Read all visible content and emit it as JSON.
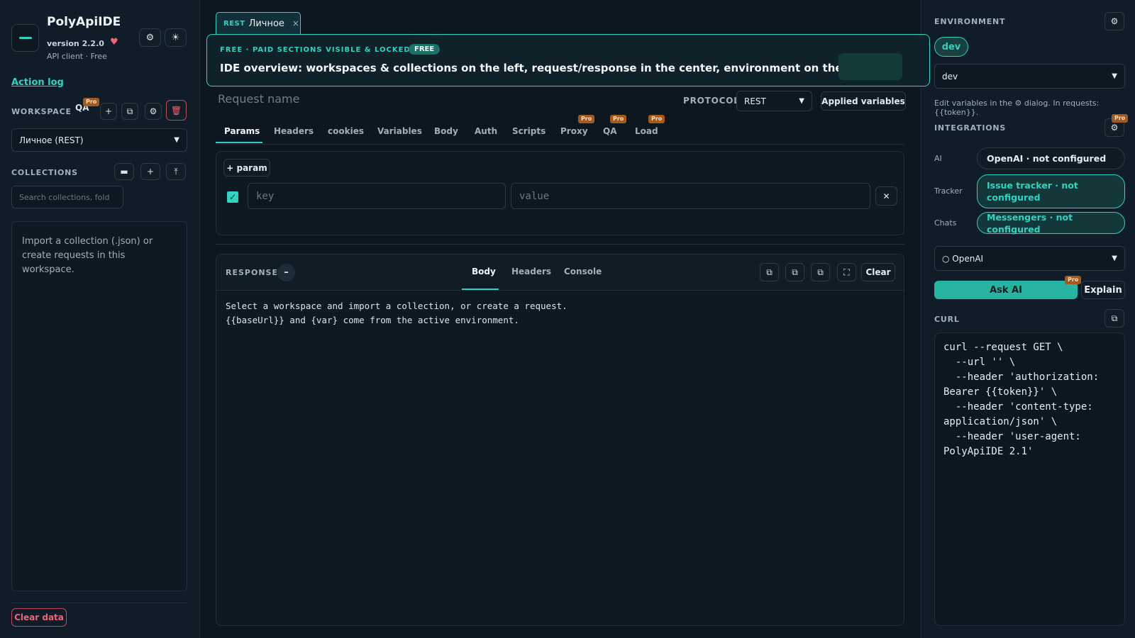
{
  "app": {
    "title": "PolyApiIDE",
    "version": "version 2.2.0",
    "subtitle": "API client · Free"
  },
  "left": {
    "action_log": "Action log",
    "workspace_label": "WORKSPACE",
    "qa_label": "QA",
    "pro_badge": "Pro",
    "workspace_value": "Личное (REST)",
    "collections_label": "COLLECTIONS",
    "search_placeholder": "Search collections, fold",
    "empty_text": "Import a collection (.json) or create requests in this workspace.",
    "clear_data": "Clear data"
  },
  "tab": {
    "tag": "REST",
    "name": "Личное",
    "close": "×"
  },
  "banner": {
    "kicker": "FREE · PAID SECTIONS VISIBLE & LOCKED",
    "badge": "FREE",
    "headline": "IDE overview: workspaces & collections on the left, request/response in the center, environment on the right."
  },
  "request": {
    "name_placeholder": "Request name",
    "protocol_label": "PROTOCOL",
    "protocol_value": "REST",
    "applied_variables": "Applied variables",
    "tabs": [
      "Params",
      "Headers",
      "cookies",
      "Variables",
      "Body",
      "Auth",
      "Scripts",
      "Proxy",
      "QA",
      "Load"
    ],
    "pro_badge": "Pro",
    "add_param": "+ param",
    "key_placeholder": "key",
    "value_placeholder": "value",
    "remove": "✕"
  },
  "response": {
    "label": "RESPONSE",
    "collapse": "–",
    "tabs": [
      "Body",
      "Headers",
      "Console"
    ],
    "clear": "Clear",
    "body": "Select a workspace and import a collection, or create a request.\n{{baseUrl}} and {var} come from the active environment."
  },
  "right": {
    "environment_label": "ENVIRONMENT",
    "env_pill": "dev",
    "env_select": "dev",
    "hint": "Edit variables in the ⚙ dialog. In requests: {{token}}.",
    "integrations_label": "INTEGRATIONS",
    "pro_badge": "Pro",
    "integrations": [
      {
        "label": "AI",
        "value": "OpenAI · not configured"
      },
      {
        "label": "Tracker",
        "value": "Issue tracker · not configured"
      },
      {
        "label": "Chats",
        "value": "Messengers · not configured"
      }
    ],
    "ai_select": "○ OpenAI",
    "ask_ai": "Ask AI",
    "explain": "Explain",
    "curl_label": "CURL",
    "curl_text": "curl --request GET \\\n  --url '' \\\n  --header 'authorization: Bearer {{token}}' \\\n  --header 'content-type: application/json' \\\n  --header 'user-agent: PolyApiIDE 2.1'"
  },
  "colors": {
    "accent": "#2dd4bf",
    "danger": "#f0627a",
    "pro_badge": "#a55a1d",
    "background": "#0f1b25"
  }
}
